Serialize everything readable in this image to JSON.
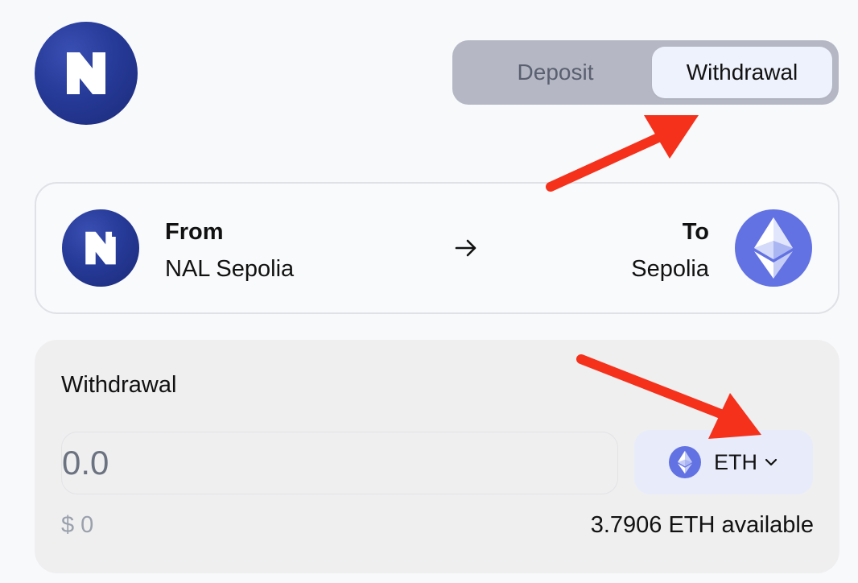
{
  "toggle": {
    "deposit_label": "Deposit",
    "withdrawal_label": "Withdrawal",
    "selected": "Withdrawal"
  },
  "route": {
    "from_label": "From",
    "from_network": "NAL Sepolia",
    "to_label": "To",
    "to_network": "Sepolia"
  },
  "panel": {
    "title": "Withdrawal",
    "amount_placeholder": "0.0",
    "token": "ETH",
    "usd_value": "$ 0",
    "available": "3.7906 ETH available"
  },
  "colors": {
    "brand_blue": "#263a98",
    "eth_purple": "#6272e3",
    "annotation_red": "#f5311c"
  },
  "icons": {
    "logo": "nal-logo-icon",
    "eth": "ethereum-icon",
    "arrow": "arrow-right-icon",
    "chevron": "chevron-down-icon"
  }
}
